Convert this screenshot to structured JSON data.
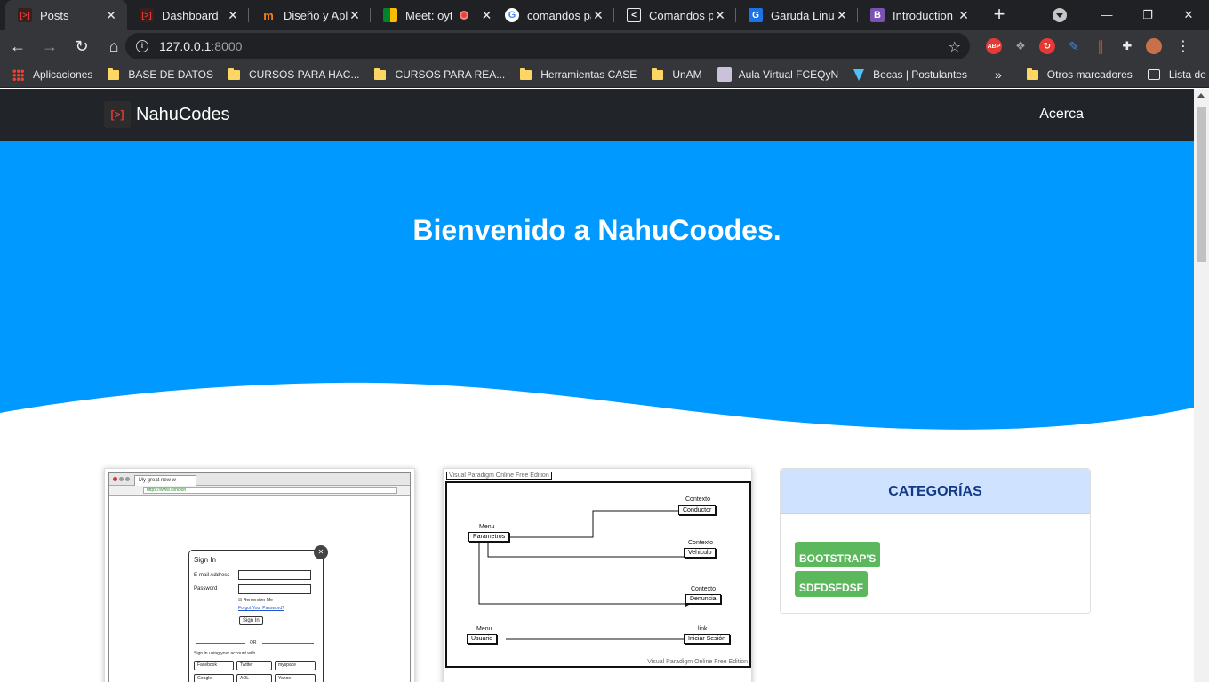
{
  "browser": {
    "tabs": [
      {
        "title": "Posts",
        "favicon": "nahucodes-icon",
        "active": true
      },
      {
        "title": "Dashboard",
        "favicon": "nahucodes-icon",
        "active": false
      },
      {
        "title": "Diseño y Aplic",
        "favicon": "moodle-icon",
        "active": false
      },
      {
        "title": "Meet: oyt",
        "favicon": "google-meet-icon",
        "active": false,
        "recording": true
      },
      {
        "title": "comandos pa",
        "favicon": "google-icon",
        "active": false
      },
      {
        "title": "Comandos pa",
        "favicon": "code-icon",
        "active": false
      },
      {
        "title": "Garuda Linux",
        "favicon": "garuda-icon",
        "active": false
      },
      {
        "title": "Introduction",
        "favicon": "bootstrap-icon",
        "active": false
      }
    ],
    "url_host": "127.0.0.1",
    "url_port": ":8000",
    "bookmarks": [
      {
        "label": "Aplicaciones",
        "icon": "apps-grid-icon"
      },
      {
        "label": "BASE DE DATOS",
        "icon": "folder-icon"
      },
      {
        "label": "CURSOS PARA HAC...",
        "icon": "folder-icon"
      },
      {
        "label": "CURSOS PARA REA...",
        "icon": "folder-icon"
      },
      {
        "label": "Herramientas CASE",
        "icon": "folder-icon"
      },
      {
        "label": "UnAM",
        "icon": "folder-icon"
      },
      {
        "label": "Aula Virtual FCEQyN",
        "icon": "image-icon"
      },
      {
        "label": "Becas | Postulantes",
        "icon": "triangle-icon"
      }
    ],
    "other_bookmarks": "Otros marcadores",
    "reading_list": "Lista de lectura",
    "more_bookmarks": "»"
  },
  "site": {
    "brand": "NahuCodes",
    "brand_logo": "[>]",
    "nav_link": "Acerca",
    "hero_title": "Bienvenido a NahuCoodes.",
    "hero_color": "#0099ff",
    "nav_color": "#212529"
  },
  "card1_mock": {
    "tab_title": "My great new w",
    "url": "https://www.sonclon",
    "dialog_title": "Sign In",
    "email_label": "E-mail Address",
    "password_label": "Password",
    "remember": "Remember Me",
    "forgot": "Forgot Your Password?",
    "signin_btn": "Sign In",
    "or": "OR",
    "social_caption": "Sign In using your account with",
    "social": [
      "Facebook",
      "Twitter",
      "myspace",
      "Google",
      "AOL",
      "Yahoo"
    ]
  },
  "card2_mock": {
    "caption_top": "Visual Paradigm Online Free Edition",
    "caption_bottom": "Visual Paradigm Online Free Edition",
    "boxes": [
      {
        "stereotype": "Menu",
        "label": "Parametros"
      },
      {
        "stereotype": "Contexto",
        "label": "Conductor"
      },
      {
        "stereotype": "Contexto",
        "label": "Vehiculo"
      },
      {
        "stereotype": "Contexto",
        "label": "Denuncia"
      },
      {
        "stereotype": "Menu",
        "label": "Usuario"
      },
      {
        "stereotype": "link",
        "label": "Iniciar Sesión"
      }
    ]
  },
  "sidebar": {
    "title": "CATEGORÍAS",
    "categories": [
      "BOOTSTRAP'S",
      "SDFDSFDSF"
    ]
  }
}
